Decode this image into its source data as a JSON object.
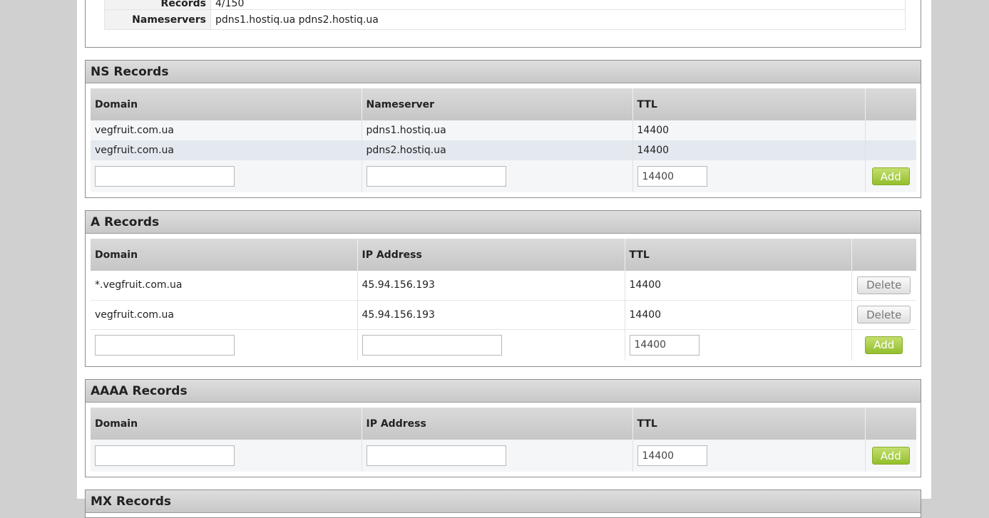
{
  "info": {
    "records_label": "Records",
    "records_value": "4/150",
    "nameservers_label": "Nameservers",
    "nameservers_value": "pdns1.hostiq.ua pdns2.hostiq.ua"
  },
  "ns": {
    "title": "NS Records",
    "columns": [
      "Domain",
      "Nameserver",
      "TTL",
      ""
    ],
    "rows": [
      {
        "domain": "vegfruit.com.ua",
        "value": "pdns1.hostiq.ua",
        "ttl": "14400"
      },
      {
        "domain": "vegfruit.com.ua",
        "value": "pdns2.hostiq.ua",
        "ttl": "14400"
      }
    ],
    "new": {
      "domain": "",
      "value": "",
      "ttl": "14400"
    },
    "add_label": "Add"
  },
  "a": {
    "title": "A Records",
    "columns": [
      "Domain",
      "IP Address",
      "TTL",
      ""
    ],
    "rows": [
      {
        "domain": "*.vegfruit.com.ua",
        "value": "45.94.156.193",
        "ttl": "14400",
        "delete_label": "Delete"
      },
      {
        "domain": "vegfruit.com.ua",
        "value": "45.94.156.193",
        "ttl": "14400",
        "delete_label": "Delete"
      }
    ],
    "new": {
      "domain": "",
      "value": "",
      "ttl": "14400"
    },
    "add_label": "Add"
  },
  "aaaa": {
    "title": "AAAA Records",
    "columns": [
      "Domain",
      "IP Address",
      "TTL",
      ""
    ],
    "new": {
      "domain": "",
      "value": "",
      "ttl": "14400"
    },
    "add_label": "Add"
  },
  "mx": {
    "title": "MX Records"
  },
  "colors": {
    "page_bg": "#d0d0d0",
    "header_gradient": "#c8c8c8",
    "add_button": "#93bf2d",
    "row_alt": "#e4e8ef"
  }
}
